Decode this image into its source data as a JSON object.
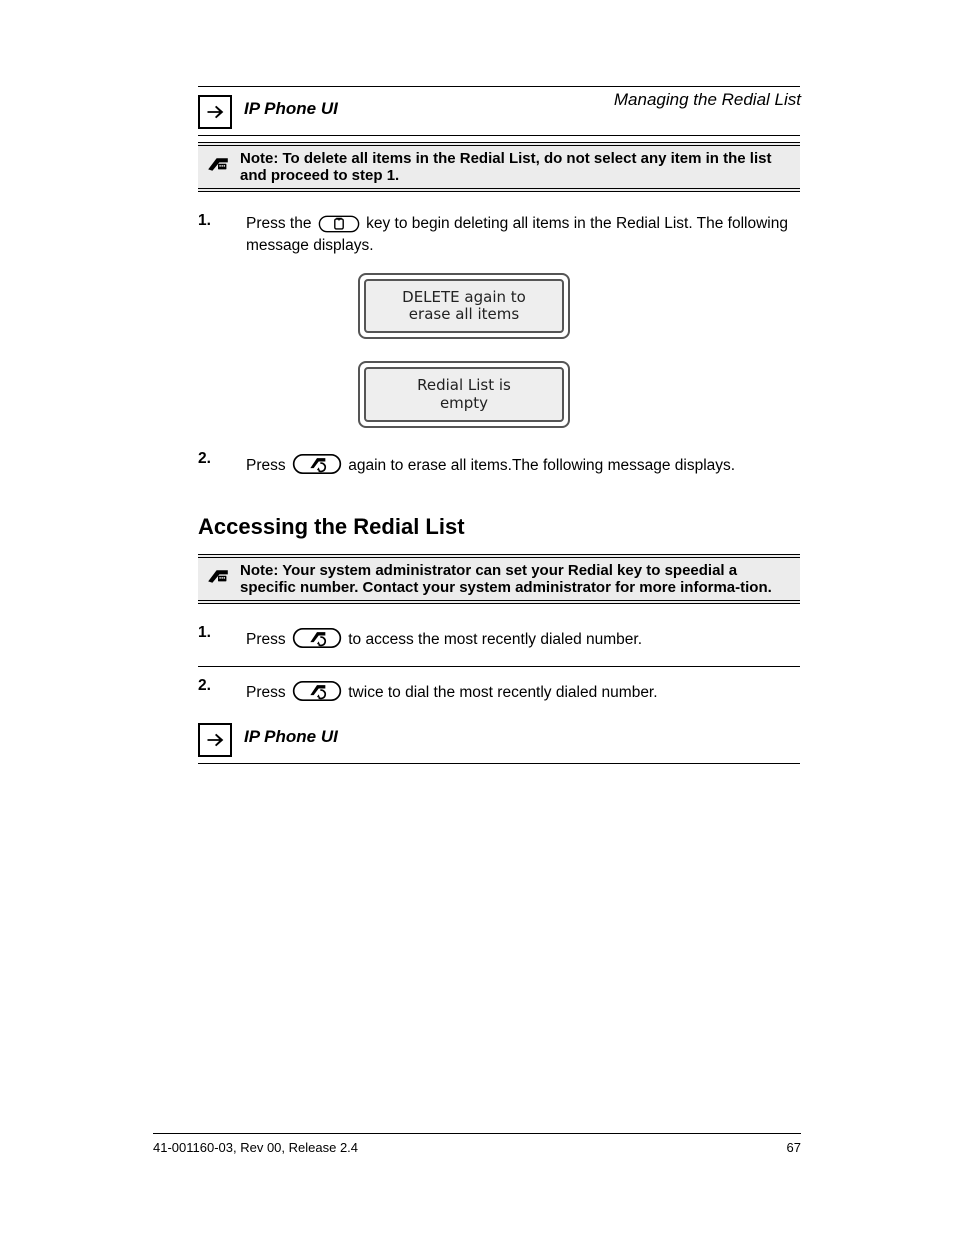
{
  "page_header_title": "Managing the Redial List",
  "sub1": {
    "heading": "IP Phone UI",
    "note": "Note: To delete all items in the Redial List, do not select any item in the list and proceed to step 1.",
    "step1_pre": "Press the ",
    "step1_post": " key to begin deleting all items in the Redial List. The following message displays.",
    "screen1_line1": "DELETE again to",
    "screen1_line2": "erase all items",
    "step2_pre": "Press ",
    "step2_post": " again to erase all items.The following message displays.",
    "screen2_line1": "Redial List is",
    "screen2_line2": "empty"
  },
  "heading2": "Accessing the Redial List",
  "sub2": {
    "heading": "IP Phone UI",
    "note_pre": "Note: Your system administrator can set your Redial key to speedial a specific number. Contact your system administrator for more informa-tion.",
    "sub_heading": "IP Phone UI",
    "step1_pre": "Press ",
    "step1_post": " to access the most recently dialed number.",
    "step2_pre": "Press ",
    "step2_post": " twice to dial the most recently dialed number."
  },
  "footer": {
    "doc_id": "41-001160-03, Rev 00, Release 2.4",
    "page_number": "67"
  }
}
